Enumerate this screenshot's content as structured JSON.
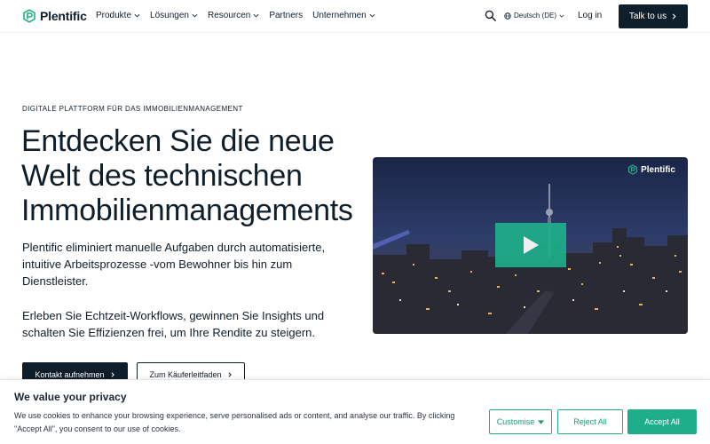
{
  "nav": {
    "logo_text": "Plentific",
    "menu": [
      {
        "label": "Produkte",
        "dropdown": true
      },
      {
        "label": "Lösungen",
        "dropdown": true
      },
      {
        "label": "Resourcen",
        "dropdown": true
      },
      {
        "label": "Partners",
        "dropdown": false
      },
      {
        "label": "Unternehmen",
        "dropdown": true
      }
    ],
    "search_icon": "search-icon",
    "language": "Deutsch (DE)",
    "login": "Log in",
    "cta": "Talk to us"
  },
  "hero": {
    "eyebrow": "DIGITALE PLATTFORM FÜR DAS IMMOBILIENMANAGEMENT",
    "headline": "Entdecken Sie die neue Welt des technischen Immobilienmanagements",
    "paragraph1": "Plentific eliminiert manuelle Aufgaben durch automatisierte, intuitive Arbeitsprozesse -vom Bewohner bis hin zum Dienstleister.",
    "paragraph2": "Erleben Sie Echtzeit-Workflows, gewinnen Sie Insights und schalten Sie Effizienzen frei, um Ihre Rendite zu steigern.",
    "primary_button": "Kontakt aufnehmen",
    "secondary_button": "Zum Käuferleitfaden"
  },
  "video": {
    "logo_text": "Plentific",
    "play_icon": "play-icon"
  },
  "cookie": {
    "title": "We value your privacy",
    "text": "We use cookies to enhance your browsing experience, serve personalised ads or content, and analyse our traffic. By clicking \"Accept All\", you consent to our use of cookies.",
    "customise": "Customise",
    "reject": "Reject All",
    "accept": "Accept All"
  },
  "colors": {
    "navy": "#0f1e2b",
    "teal": "#1eaf8a"
  }
}
